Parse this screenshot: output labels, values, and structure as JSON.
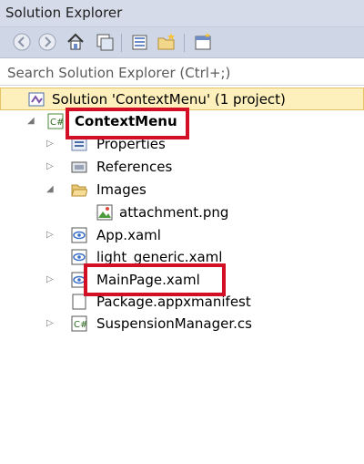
{
  "window": {
    "title": "Solution Explorer"
  },
  "toolbar": {
    "buttons": [
      "back-icon",
      "forward-icon",
      "home-icon",
      "switch-views-icon",
      "properties-icon",
      "new-folder-icon",
      "show-all-files-icon"
    ]
  },
  "search": {
    "placeholder": "Search Solution Explorer (Ctrl+;)",
    "value": ""
  },
  "tree": {
    "solution": {
      "label": "Solution 'ContextMenu' (1 project)"
    },
    "project": {
      "label": "ContextMenu"
    },
    "items": [
      {
        "label": "Properties"
      },
      {
        "label": "References"
      },
      {
        "label": "Images"
      },
      {
        "label": "attachment.png"
      },
      {
        "label": "App.xaml"
      },
      {
        "label": "light_generic.xaml"
      },
      {
        "label": "MainPage.xaml"
      },
      {
        "label": "Package.appxmanifest"
      },
      {
        "label": "SuspensionManager.cs"
      }
    ]
  },
  "colors": {
    "selection": "#fdf0bc",
    "highlight": "#d20f24",
    "chrome": "#cfd6e5"
  }
}
